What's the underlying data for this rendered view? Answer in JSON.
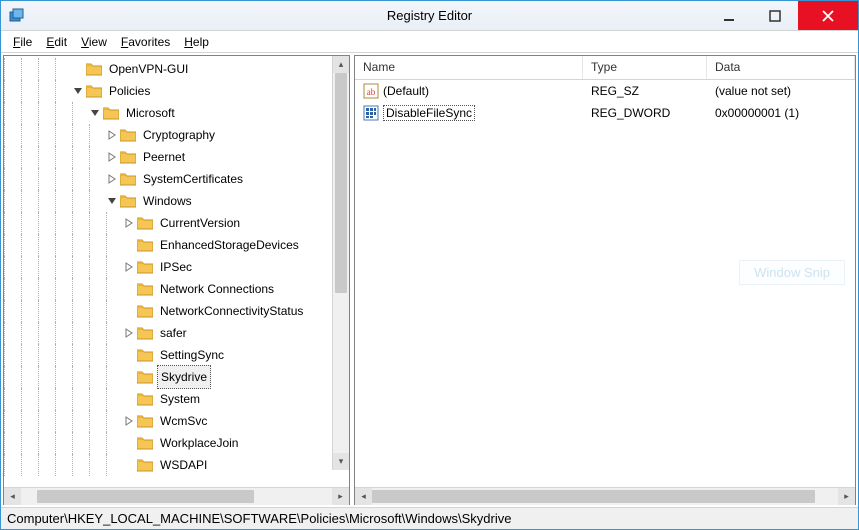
{
  "window": {
    "title": "Registry Editor"
  },
  "menu": {
    "file": "File",
    "edit": "Edit",
    "view": "View",
    "favorites": "Favorites",
    "help": "Help"
  },
  "tree": {
    "nodes": [
      {
        "indent": 4,
        "expander": "none",
        "label": "OpenVPN-GUI"
      },
      {
        "indent": 4,
        "expander": "expanded",
        "label": "Policies"
      },
      {
        "indent": 5,
        "expander": "expanded",
        "label": "Microsoft"
      },
      {
        "indent": 6,
        "expander": "collapsed",
        "label": "Cryptography"
      },
      {
        "indent": 6,
        "expander": "collapsed",
        "label": "Peernet"
      },
      {
        "indent": 6,
        "expander": "collapsed",
        "label": "SystemCertificates"
      },
      {
        "indent": 6,
        "expander": "expanded",
        "label": "Windows"
      },
      {
        "indent": 7,
        "expander": "collapsed",
        "label": "CurrentVersion"
      },
      {
        "indent": 7,
        "expander": "none",
        "label": "EnhancedStorageDevices"
      },
      {
        "indent": 7,
        "expander": "collapsed",
        "label": "IPSec"
      },
      {
        "indent": 7,
        "expander": "none",
        "label": "Network Connections"
      },
      {
        "indent": 7,
        "expander": "none",
        "label": "NetworkConnectivityStatus"
      },
      {
        "indent": 7,
        "expander": "collapsed",
        "label": "safer"
      },
      {
        "indent": 7,
        "expander": "none",
        "label": "SettingSync"
      },
      {
        "indent": 7,
        "expander": "none",
        "label": "Skydrive",
        "selected": true
      },
      {
        "indent": 7,
        "expander": "none",
        "label": "System"
      },
      {
        "indent": 7,
        "expander": "collapsed",
        "label": "WcmSvc"
      },
      {
        "indent": 7,
        "expander": "none",
        "label": "WorkplaceJoin"
      },
      {
        "indent": 7,
        "expander": "none",
        "label": "WSDAPI"
      }
    ]
  },
  "list": {
    "columns": {
      "name": "Name",
      "type": "Type",
      "data": "Data"
    },
    "rows": [
      {
        "icon": "string",
        "name": "(Default)",
        "type": "REG_SZ",
        "data": "(value not set)",
        "selected": false
      },
      {
        "icon": "binary",
        "name": "DisableFileSync",
        "type": "REG_DWORD",
        "data": "0x00000001 (1)",
        "selected": true
      }
    ]
  },
  "statusbar": {
    "path": "Computer\\HKEY_LOCAL_MACHINE\\SOFTWARE\\Policies\\Microsoft\\Windows\\Skydrive"
  },
  "watermark": "Window Snip"
}
